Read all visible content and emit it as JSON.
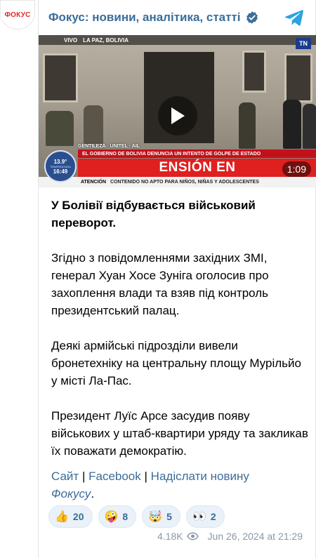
{
  "avatar": {
    "text": "ФОКУС"
  },
  "header": {
    "channel_title": "Фокус: новини, аналітика, статті"
  },
  "video": {
    "top_left": "VIVO",
    "location": "LA PAZ, BOLIVIA",
    "tn_logo": "TN",
    "gentileza": "GENTILEZA",
    "source": "UNITEL · AIL",
    "headline": "EL GOBIERNO DE BOLIVIA DENUNCIA UN INTENTO DE GOLPE DE ESTADO",
    "ticker": "ENSIÓN EN",
    "attention_label": "ATENCIÓN",
    "attention_text": "CONTENIDO NO APTO PARA NIÑOS, NIÑAS Y ADOLESCENTES",
    "weather_temp": "13.9°",
    "weather_label": "TEMPERATURA",
    "weather_clock": "16:49",
    "duration": "1:09"
  },
  "post": {
    "paragraph_1": "У Болівії відбувається військовий переворот.",
    "paragraph_2": "Згідно з повідомленнями західних ЗМІ, генерал Хуан Хосе Зуніга оголосив про захоплення влади та взяв під контроль президентський палац.",
    "paragraph_3": "Деякі армійські підрозділи вивели бронетехніку на центральну площу Мурільйо у місті Ла-Пас.",
    "paragraph_4": "Президент Луїс Арсе засудив появу військових у штаб-квартири уряду та закликав їх поважати демократію."
  },
  "links": {
    "site": "Сайт",
    "separator": "|",
    "facebook": "Facebook",
    "submit_news": "Надіслати новину",
    "focus": "Фокусу",
    "period": "."
  },
  "reactions": [
    {
      "emoji": "👍",
      "icon": "thumbs-up-icon",
      "count": "20"
    },
    {
      "emoji": "🤪",
      "icon": "zany-face-icon",
      "count": "8"
    },
    {
      "emoji": "🤯",
      "icon": "exploding-head-icon",
      "count": "5"
    },
    {
      "emoji": "👀",
      "icon": "eyes-icon",
      "count": "2"
    }
  ],
  "footer": {
    "views": "4.18K",
    "date": "Jun 26, 2024 at 21:29"
  },
  "colors": {
    "accent": "#3a6d99",
    "telegram": "#2aa3df",
    "brand_red": "#e3262d"
  }
}
